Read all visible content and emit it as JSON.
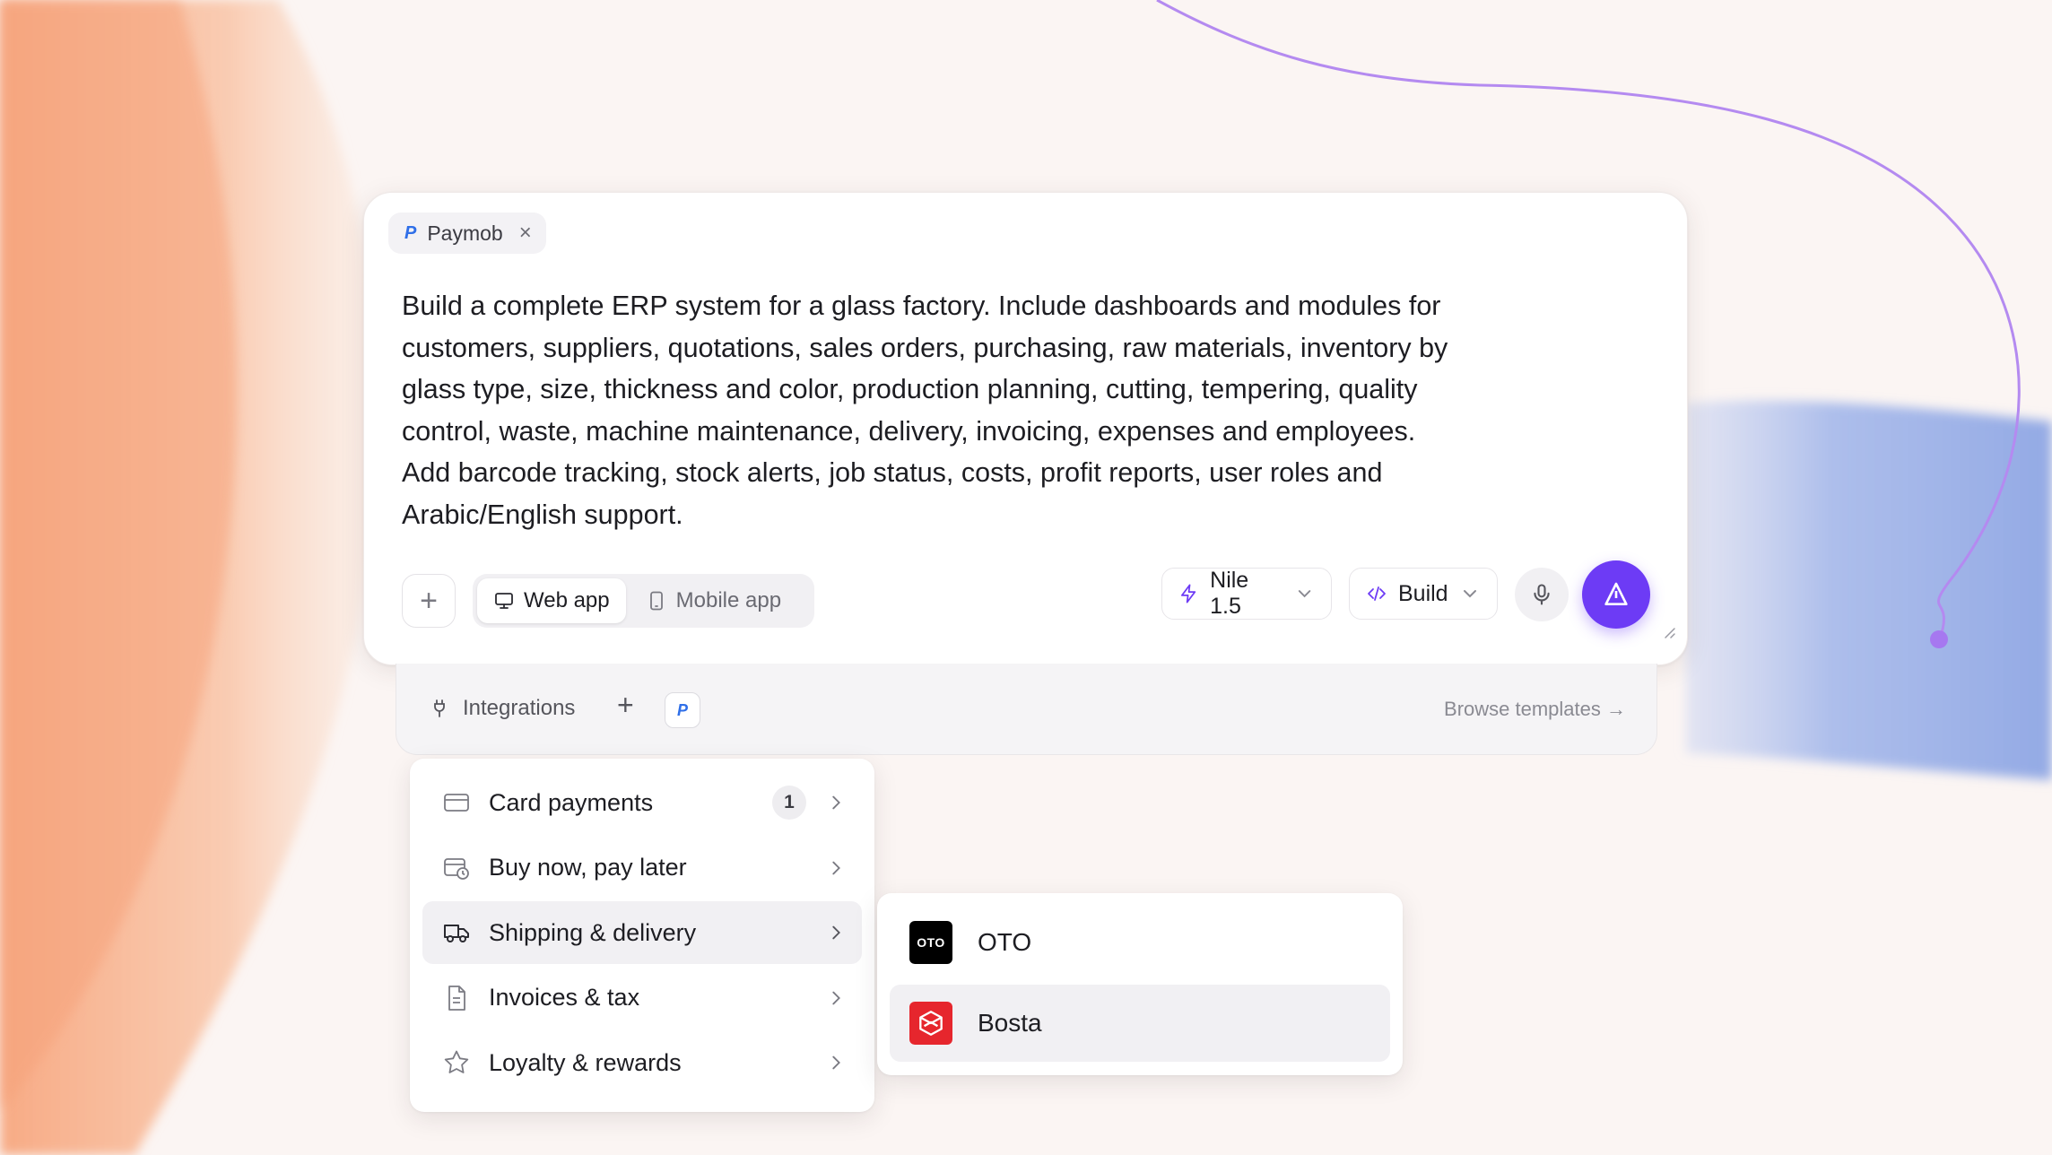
{
  "prompt": {
    "chip_logo": "P",
    "chip_label": "Paymob",
    "chip_close": "×",
    "text": "Build a complete ERP system for a glass factory. Include dashboards and modules for customers, suppliers, quotations, sales orders, purchasing, raw materials, inventory by glass type, size, thickness and color, production planning, cutting, tempering, quality control, waste, machine maintenance, delivery, invoicing, expenses and employees. Add barcode tracking, stock alerts, job status, costs, profit reports, user roles and Arabic/English support."
  },
  "toolbar": {
    "plus": "+",
    "app_types": [
      {
        "label": "Web app",
        "active": true,
        "icon": "monitor-icon"
      },
      {
        "label": "Mobile app",
        "active": false,
        "icon": "phone-icon"
      }
    ],
    "model_label": "Nile 1.5",
    "mode_label": "Build",
    "chevron": "⌄"
  },
  "integrations": {
    "label": "Integrations",
    "plus": "+",
    "logo": "P",
    "browse": "Browse templates →"
  },
  "menu": {
    "items": [
      {
        "label": "Card payments",
        "badge": "1",
        "icon": "credit-card-icon"
      },
      {
        "label": "Buy now, pay later",
        "icon": "calendar-clock-icon"
      },
      {
        "label": "Shipping & delivery",
        "icon": "truck-icon",
        "active": true
      },
      {
        "label": "Invoices & tax",
        "icon": "document-icon"
      },
      {
        "label": "Loyalty & rewards",
        "icon": "star-icon"
      }
    ]
  },
  "submenu": {
    "items": [
      {
        "label": "OTO",
        "logo_text": "OTO"
      },
      {
        "label": "Bosta",
        "active": true
      }
    ]
  },
  "colors": {
    "accent": "#6d3bf5",
    "paymob_blue": "#2f6fe8",
    "bosta_red": "#e6262d",
    "brush_orange": "#f6b08e",
    "brush_blue": "#8fa8e6",
    "curve_purple": "#b48af0"
  }
}
